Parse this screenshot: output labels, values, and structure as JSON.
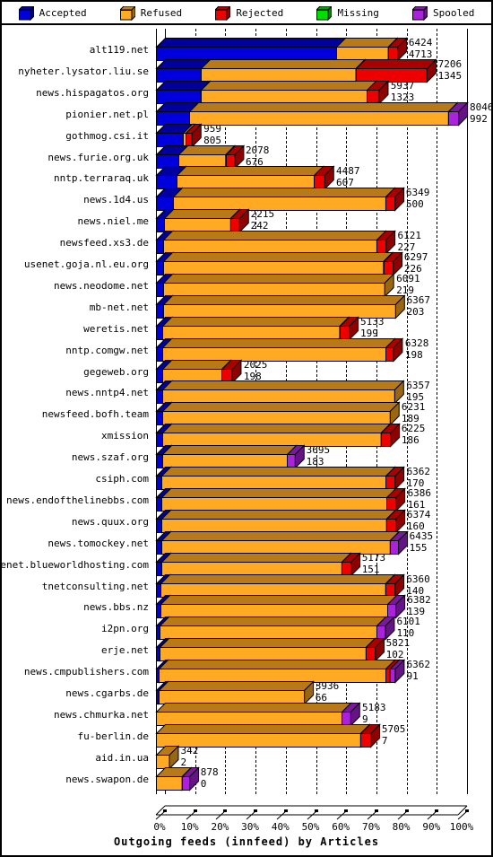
{
  "legend": {
    "items": [
      {
        "label": "Accepted",
        "color": "#0000dd",
        "icon": "cube-icon"
      },
      {
        "label": "Refused",
        "color": "#ffaa22",
        "icon": "cube-icon"
      },
      {
        "label": "Rejected",
        "color": "#ee0000",
        "icon": "cube-icon"
      },
      {
        "label": "Missing",
        "color": "#00dd00",
        "icon": "cube-icon"
      },
      {
        "label": "Spooled",
        "color": "#aa22dd",
        "icon": "cube-icon"
      }
    ]
  },
  "axis": {
    "title": "Outgoing feeds (innfeed) by Articles",
    "ticks": [
      "0%",
      "10%",
      "20%",
      "30%",
      "40%",
      "50%",
      "60%",
      "70%",
      "80%",
      "90%",
      "100%"
    ],
    "tick_values": [
      0,
      10,
      20,
      30,
      40,
      50,
      60,
      70,
      80,
      90,
      100
    ]
  },
  "chart_data": {
    "type": "bar",
    "orientation": "horizontal",
    "stacked": true,
    "title": "Outgoing feeds (innfeed) by Articles",
    "xlabel": "Outgoing feeds (innfeed) by Articles",
    "ylabel": "",
    "xlim": [
      0,
      100
    ],
    "xunit": "percent",
    "grid": true,
    "legend_position": "top",
    "series": [
      {
        "name": "Accepted",
        "color": "#0000dd"
      },
      {
        "name": "Refused",
        "color": "#ffaa22"
      },
      {
        "name": "Rejected",
        "color": "#ee0000"
      },
      {
        "name": "Missing",
        "color": "#00dd00"
      },
      {
        "name": "Spooled",
        "color": "#aa22dd"
      }
    ],
    "categories": [
      "alt119.net",
      "nyheter.lysator.liu.se",
      "news.hispagatos.org",
      "pionier.net.pl",
      "gothmog.csi.it",
      "news.furie.org.uk",
      "nntp.terraraq.uk",
      "news.1d4.us",
      "news.niel.me",
      "newsfeed.xs3.de",
      "usenet.goja.nl.eu.org",
      "news.neodome.net",
      "mb-net.net",
      "weretis.net",
      "nntp.comgw.net",
      "gegeweb.org",
      "news.nntp4.net",
      "newsfeed.bofh.team",
      "xmission",
      "news.szaf.org",
      "csiph.com",
      "news.endofthelinebbs.com",
      "news.quux.org",
      "news.tomockey.net",
      "usenet.blueworldhosting.com",
      "tnetconsulting.net",
      "news.bbs.nz",
      "i2pn.org",
      "erje.net",
      "news.cmpublishers.com",
      "news.cgarbs.de",
      "news.chmurka.net",
      "fu-berlin.de",
      "aid.in.ua",
      "news.swapon.de"
    ],
    "rows": [
      {
        "label": "alt119.net",
        "total": 6424,
        "accepted_label": 4713,
        "pct_total": 79.8,
        "segs": [
          {
            "s": "Accepted",
            "pct": 59.7
          },
          {
            "s": "Refused",
            "pct": 17.1
          },
          {
            "s": "Rejected",
            "pct": 3.0
          }
        ]
      },
      {
        "label": "nyheter.lysator.liu.se",
        "total": 7206,
        "accepted_label": 1345,
        "pct_total": 89.5,
        "segs": [
          {
            "s": "Accepted",
            "pct": 14.9
          },
          {
            "s": "Refused",
            "pct": 51.2
          },
          {
            "s": "Rejected",
            "pct": 23.4
          }
        ]
      },
      {
        "label": "news.hispagatos.org",
        "total": 5937,
        "accepted_label": 1323,
        "pct_total": 73.8,
        "segs": [
          {
            "s": "Accepted",
            "pct": 14.7
          },
          {
            "s": "Refused",
            "pct": 55.1
          },
          {
            "s": "Rejected",
            "pct": 4.0
          }
        ]
      },
      {
        "label": "pionier.net.pl",
        "total": 8046,
        "accepted_label": 992,
        "pct_total": 100.0,
        "segs": [
          {
            "s": "Accepted",
            "pct": 11.0
          },
          {
            "s": "Refused",
            "pct": 85.7
          },
          {
            "s": "Spooled",
            "pct": 3.3
          }
        ]
      },
      {
        "label": "gothmog.csi.it",
        "total": 959,
        "accepted_label": 805,
        "pct_total": 11.9,
        "segs": [
          {
            "s": "Accepted",
            "pct": 9.0
          },
          {
            "s": "Refused",
            "pct": 0.9
          },
          {
            "s": "Rejected",
            "pct": 2.0
          }
        ]
      },
      {
        "label": "news.furie.org.uk",
        "total": 2078,
        "accepted_label": 676,
        "pct_total": 25.8,
        "segs": [
          {
            "s": "Accepted",
            "pct": 7.5
          },
          {
            "s": "Refused",
            "pct": 15.5
          },
          {
            "s": "Rejected",
            "pct": 2.8
          }
        ]
      },
      {
        "label": "nntp.terraraq.uk",
        "total": 4487,
        "accepted_label": 607,
        "pct_total": 55.8,
        "segs": [
          {
            "s": "Accepted",
            "pct": 6.8
          },
          {
            "s": "Refused",
            "pct": 45.5
          },
          {
            "s": "Rejected",
            "pct": 3.5
          }
        ]
      },
      {
        "label": "news.1d4.us",
        "total": 6349,
        "accepted_label": 500,
        "pct_total": 78.9,
        "segs": [
          {
            "s": "Accepted",
            "pct": 5.6
          },
          {
            "s": "Refused",
            "pct": 70.3
          },
          {
            "s": "Rejected",
            "pct": 3.0
          }
        ]
      },
      {
        "label": "news.niel.me",
        "total": 2215,
        "accepted_label": 242,
        "pct_total": 27.5,
        "segs": [
          {
            "s": "Accepted",
            "pct": 2.7
          },
          {
            "s": "Refused",
            "pct": 21.9
          },
          {
            "s": "Rejected",
            "pct": 2.9
          }
        ]
      },
      {
        "label": "newsfeed.xs3.de",
        "total": 6121,
        "accepted_label": 227,
        "pct_total": 76.1,
        "segs": [
          {
            "s": "Accepted",
            "pct": 2.5
          },
          {
            "s": "Refused",
            "pct": 70.6
          },
          {
            "s": "Rejected",
            "pct": 3.0
          }
        ]
      },
      {
        "label": "usenet.goja.nl.eu.org",
        "total": 6297,
        "accepted_label": 226,
        "pct_total": 78.3,
        "segs": [
          {
            "s": "Accepted",
            "pct": 2.5
          },
          {
            "s": "Refused",
            "pct": 72.8
          },
          {
            "s": "Rejected",
            "pct": 3.0
          }
        ]
      },
      {
        "label": "news.neodome.net",
        "total": 6091,
        "accepted_label": 219,
        "pct_total": 75.7,
        "segs": [
          {
            "s": "Accepted",
            "pct": 2.5
          },
          {
            "s": "Refused",
            "pct": 73.2
          }
        ]
      },
      {
        "label": "mb-net.net",
        "total": 6367,
        "accepted_label": 203,
        "pct_total": 79.1,
        "segs": [
          {
            "s": "Accepted",
            "pct": 2.3
          },
          {
            "s": "Refused",
            "pct": 76.8
          }
        ]
      },
      {
        "label": "weretis.net",
        "total": 5133,
        "accepted_label": 199,
        "pct_total": 63.8,
        "segs": [
          {
            "s": "Accepted",
            "pct": 2.2
          },
          {
            "s": "Refused",
            "pct": 58.6
          },
          {
            "s": "Rejected",
            "pct": 3.0
          }
        ]
      },
      {
        "label": "nntp.comgw.net",
        "total": 6328,
        "accepted_label": 198,
        "pct_total": 78.6,
        "segs": [
          {
            "s": "Accepted",
            "pct": 2.2
          },
          {
            "s": "Refused",
            "pct": 73.9
          },
          {
            "s": "Rejected",
            "pct": 2.5
          }
        ]
      },
      {
        "label": "gegeweb.org",
        "total": 2025,
        "accepted_label": 198,
        "pct_total": 25.2,
        "segs": [
          {
            "s": "Accepted",
            "pct": 2.2
          },
          {
            "s": "Refused",
            "pct": 19.6
          },
          {
            "s": "Rejected",
            "pct": 3.4
          }
        ]
      },
      {
        "label": "news.nntp4.net",
        "total": 6357,
        "accepted_label": 195,
        "pct_total": 79.0,
        "segs": [
          {
            "s": "Accepted",
            "pct": 2.2
          },
          {
            "s": "Refused",
            "pct": 76.8
          }
        ]
      },
      {
        "label": "newsfeed.bofh.team",
        "total": 6231,
        "accepted_label": 189,
        "pct_total": 77.4,
        "segs": [
          {
            "s": "Accepted",
            "pct": 2.1
          },
          {
            "s": "Refused",
            "pct": 75.3
          }
        ]
      },
      {
        "label": "xmission",
        "total": 6225,
        "accepted_label": 186,
        "pct_total": 77.4,
        "segs": [
          {
            "s": "Accepted",
            "pct": 2.1
          },
          {
            "s": "Refused",
            "pct": 72.3
          },
          {
            "s": "Rejected",
            "pct": 3.0
          }
        ]
      },
      {
        "label": "news.szaf.org",
        "total": 3695,
        "accepted_label": 183,
        "pct_total": 45.9,
        "segs": [
          {
            "s": "Accepted",
            "pct": 2.0
          },
          {
            "s": "Refused",
            "pct": 41.3
          },
          {
            "s": "Spooled",
            "pct": 2.6
          }
        ]
      },
      {
        "label": "csiph.com",
        "total": 6362,
        "accepted_label": 170,
        "pct_total": 79.1,
        "segs": [
          {
            "s": "Accepted",
            "pct": 1.9
          },
          {
            "s": "Refused",
            "pct": 74.2
          },
          {
            "s": "Rejected",
            "pct": 3.0
          }
        ]
      },
      {
        "label": "news.endofthelinebbs.com",
        "total": 6386,
        "accepted_label": 161,
        "pct_total": 79.4,
        "segs": [
          {
            "s": "Accepted",
            "pct": 1.8
          },
          {
            "s": "Refused",
            "pct": 74.6
          },
          {
            "s": "Rejected",
            "pct": 3.0
          }
        ]
      },
      {
        "label": "news.quux.org",
        "total": 6374,
        "accepted_label": 160,
        "pct_total": 79.2,
        "segs": [
          {
            "s": "Accepted",
            "pct": 1.8
          },
          {
            "s": "Refused",
            "pct": 74.4
          },
          {
            "s": "Rejected",
            "pct": 3.0
          }
        ]
      },
      {
        "label": "news.tomockey.net",
        "total": 6435,
        "accepted_label": 155,
        "pct_total": 80.0,
        "segs": [
          {
            "s": "Accepted",
            "pct": 1.7
          },
          {
            "s": "Refused",
            "pct": 75.6
          },
          {
            "s": "Spooled",
            "pct": 2.7
          }
        ]
      },
      {
        "label": "usenet.blueworldhosting.com",
        "total": 5173,
        "accepted_label": 151,
        "pct_total": 64.3,
        "segs": [
          {
            "s": "Accepted",
            "pct": 1.7
          },
          {
            "s": "Refused",
            "pct": 59.6
          },
          {
            "s": "Rejected",
            "pct": 3.0
          }
        ]
      },
      {
        "label": "tnetconsulting.net",
        "total": 6360,
        "accepted_label": 140,
        "pct_total": 79.0,
        "segs": [
          {
            "s": "Accepted",
            "pct": 1.6
          },
          {
            "s": "Refused",
            "pct": 74.4
          },
          {
            "s": "Rejected",
            "pct": 3.0
          }
        ]
      },
      {
        "label": "news.bbs.nz",
        "total": 6382,
        "accepted_label": 139,
        "pct_total": 79.3,
        "segs": [
          {
            "s": "Accepted",
            "pct": 1.5
          },
          {
            "s": "Refused",
            "pct": 75.1
          },
          {
            "s": "Spooled",
            "pct": 2.7
          }
        ]
      },
      {
        "label": "i2pn.org",
        "total": 6101,
        "accepted_label": 110,
        "pct_total": 75.8,
        "segs": [
          {
            "s": "Accepted",
            "pct": 1.2
          },
          {
            "s": "Refused",
            "pct": 71.8
          },
          {
            "s": "Spooled",
            "pct": 2.8
          }
        ]
      },
      {
        "label": "erje.net",
        "total": 5821,
        "accepted_label": 102,
        "pct_total": 72.3,
        "segs": [
          {
            "s": "Accepted",
            "pct": 1.1
          },
          {
            "s": "Refused",
            "pct": 68.2
          },
          {
            "s": "Rejected",
            "pct": 3.0
          }
        ]
      },
      {
        "label": "news.cmpublishers.com",
        "total": 6362,
        "accepted_label": 91,
        "pct_total": 79.1,
        "segs": [
          {
            "s": "Accepted",
            "pct": 1.0
          },
          {
            "s": "Refused",
            "pct": 75.1
          },
          {
            "s": "Rejected",
            "pct": 1.4
          },
          {
            "s": "Spooled",
            "pct": 1.6
          }
        ]
      },
      {
        "label": "news.cgarbs.de",
        "total": 3936,
        "accepted_label": 66,
        "pct_total": 48.9,
        "segs": [
          {
            "s": "Accepted",
            "pct": 0.8
          },
          {
            "s": "Refused",
            "pct": 48.1
          }
        ]
      },
      {
        "label": "news.chmurka.net",
        "total": 5183,
        "accepted_label": 9,
        "pct_total": 64.4,
        "segs": [
          {
            "s": "Refused",
            "pct": 61.5
          },
          {
            "s": "Spooled",
            "pct": 2.9
          }
        ]
      },
      {
        "label": "fu-berlin.de",
        "total": 5705,
        "accepted_label": 7,
        "pct_total": 70.9,
        "segs": [
          {
            "s": "Refused",
            "pct": 67.6
          },
          {
            "s": "Rejected",
            "pct": 3.3
          }
        ]
      },
      {
        "label": "aid.in.ua",
        "total": 342,
        "accepted_label": 2,
        "pct_total": 4.3,
        "segs": [
          {
            "s": "Refused",
            "pct": 4.3
          }
        ]
      },
      {
        "label": "news.swapon.de",
        "total": 878,
        "accepted_label": 0,
        "pct_total": 10.9,
        "segs": [
          {
            "s": "Refused",
            "pct": 8.5
          },
          {
            "s": "Spooled",
            "pct": 2.4
          }
        ]
      }
    ]
  }
}
